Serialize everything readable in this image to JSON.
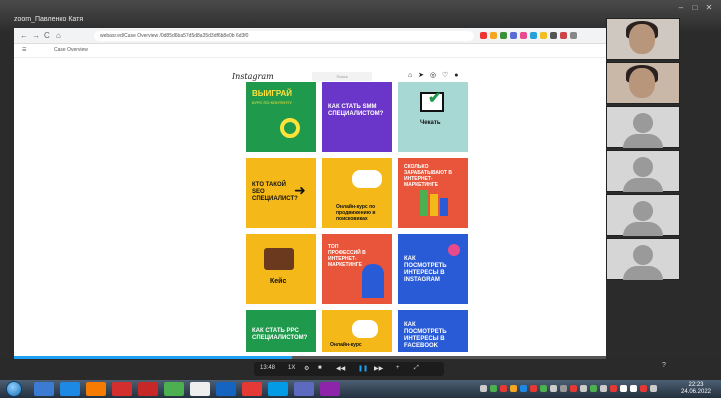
{
  "zoom": {
    "window_title": "zoom_Павленко Катя",
    "minimize": "–",
    "maximize": "□",
    "close": "✕",
    "help": "?"
  },
  "browser": {
    "url": "webasr.ed/Case Overview /0d85d6ba57d5d8a35d3df6b8e0b 6d3f0",
    "nav_back": "←",
    "nav_forward": "→",
    "nav_reload": "C",
    "nav_home": "⌂",
    "tab_label": "Case Overview"
  },
  "instagram": {
    "logo": "Instagram",
    "search_placeholder": "Поиск",
    "icons": [
      "home-icon",
      "send-icon",
      "compass-icon",
      "heart-icon",
      "profile-icon"
    ]
  },
  "tiles": [
    {
      "title": "ВЫИГРАЙ",
      "sub": "КУРС ПО КОНТЕНТУ",
      "bg": "#1f9a4d",
      "fg": "#ffe23a"
    },
    {
      "title": "КАК СТАТЬ SMM СПЕЦИАЛИСТОМ?",
      "sub": "",
      "bg": "#6a35c9",
      "fg": "#ffffff"
    },
    {
      "title": "Чекать",
      "sub": "",
      "bg": "#a8d8d4",
      "fg": "#111111"
    },
    {
      "title": "КТО ТАКОЙ SEO СПЕЦИАЛИСТ?",
      "sub": "",
      "bg": "#f4b818",
      "fg": "#111111"
    },
    {
      "title": "Онлайн-курс по продвижению в поисковиках",
      "sub": "",
      "bg": "#f4b818",
      "fg": "#111111"
    },
    {
      "title": "СКОЛЬКО ЗАРАБАТЫВАЮТ В ИНТЕРНЕТ-МАРКЕТИНГЕ",
      "sub": "",
      "bg": "#e8553a",
      "fg": "#ffffff"
    },
    {
      "title": "Кейс",
      "sub": "",
      "bg": "#f4b818",
      "fg": "#111111"
    },
    {
      "title": "ТОП ПРОФЕССИЙ В ИНТЕРНЕТ-МАРКЕТИНГЕ",
      "sub": "",
      "bg": "#e8553a",
      "fg": "#ffffff"
    },
    {
      "title": "КАК ПОСМОТРЕТЬ ИНТЕРЕСЫ В INSTAGRAM",
      "sub": "",
      "bg": "#2a5bd7",
      "fg": "#ffffff"
    },
    {
      "title": "КАК СТАТЬ PPC СПЕЦИАЛИСТОМ?",
      "sub": "",
      "bg": "#1f9a4d",
      "fg": "#ffffff"
    },
    {
      "title": "Онлайн-курс",
      "sub": "",
      "bg": "#f4b818",
      "fg": "#111111"
    },
    {
      "title": "КАК ПОСМОТРЕТЬ ИНТЕРЕСЫ В FACEBOOK",
      "sub": "",
      "bg": "#2a5bd7",
      "fg": "#ffffff"
    }
  ],
  "player": {
    "time": "13:48",
    "speed": "1X",
    "progress": 0.47
  },
  "taskbar": {
    "clock_time": "22:23",
    "clock_date": "24.06.2022"
  }
}
